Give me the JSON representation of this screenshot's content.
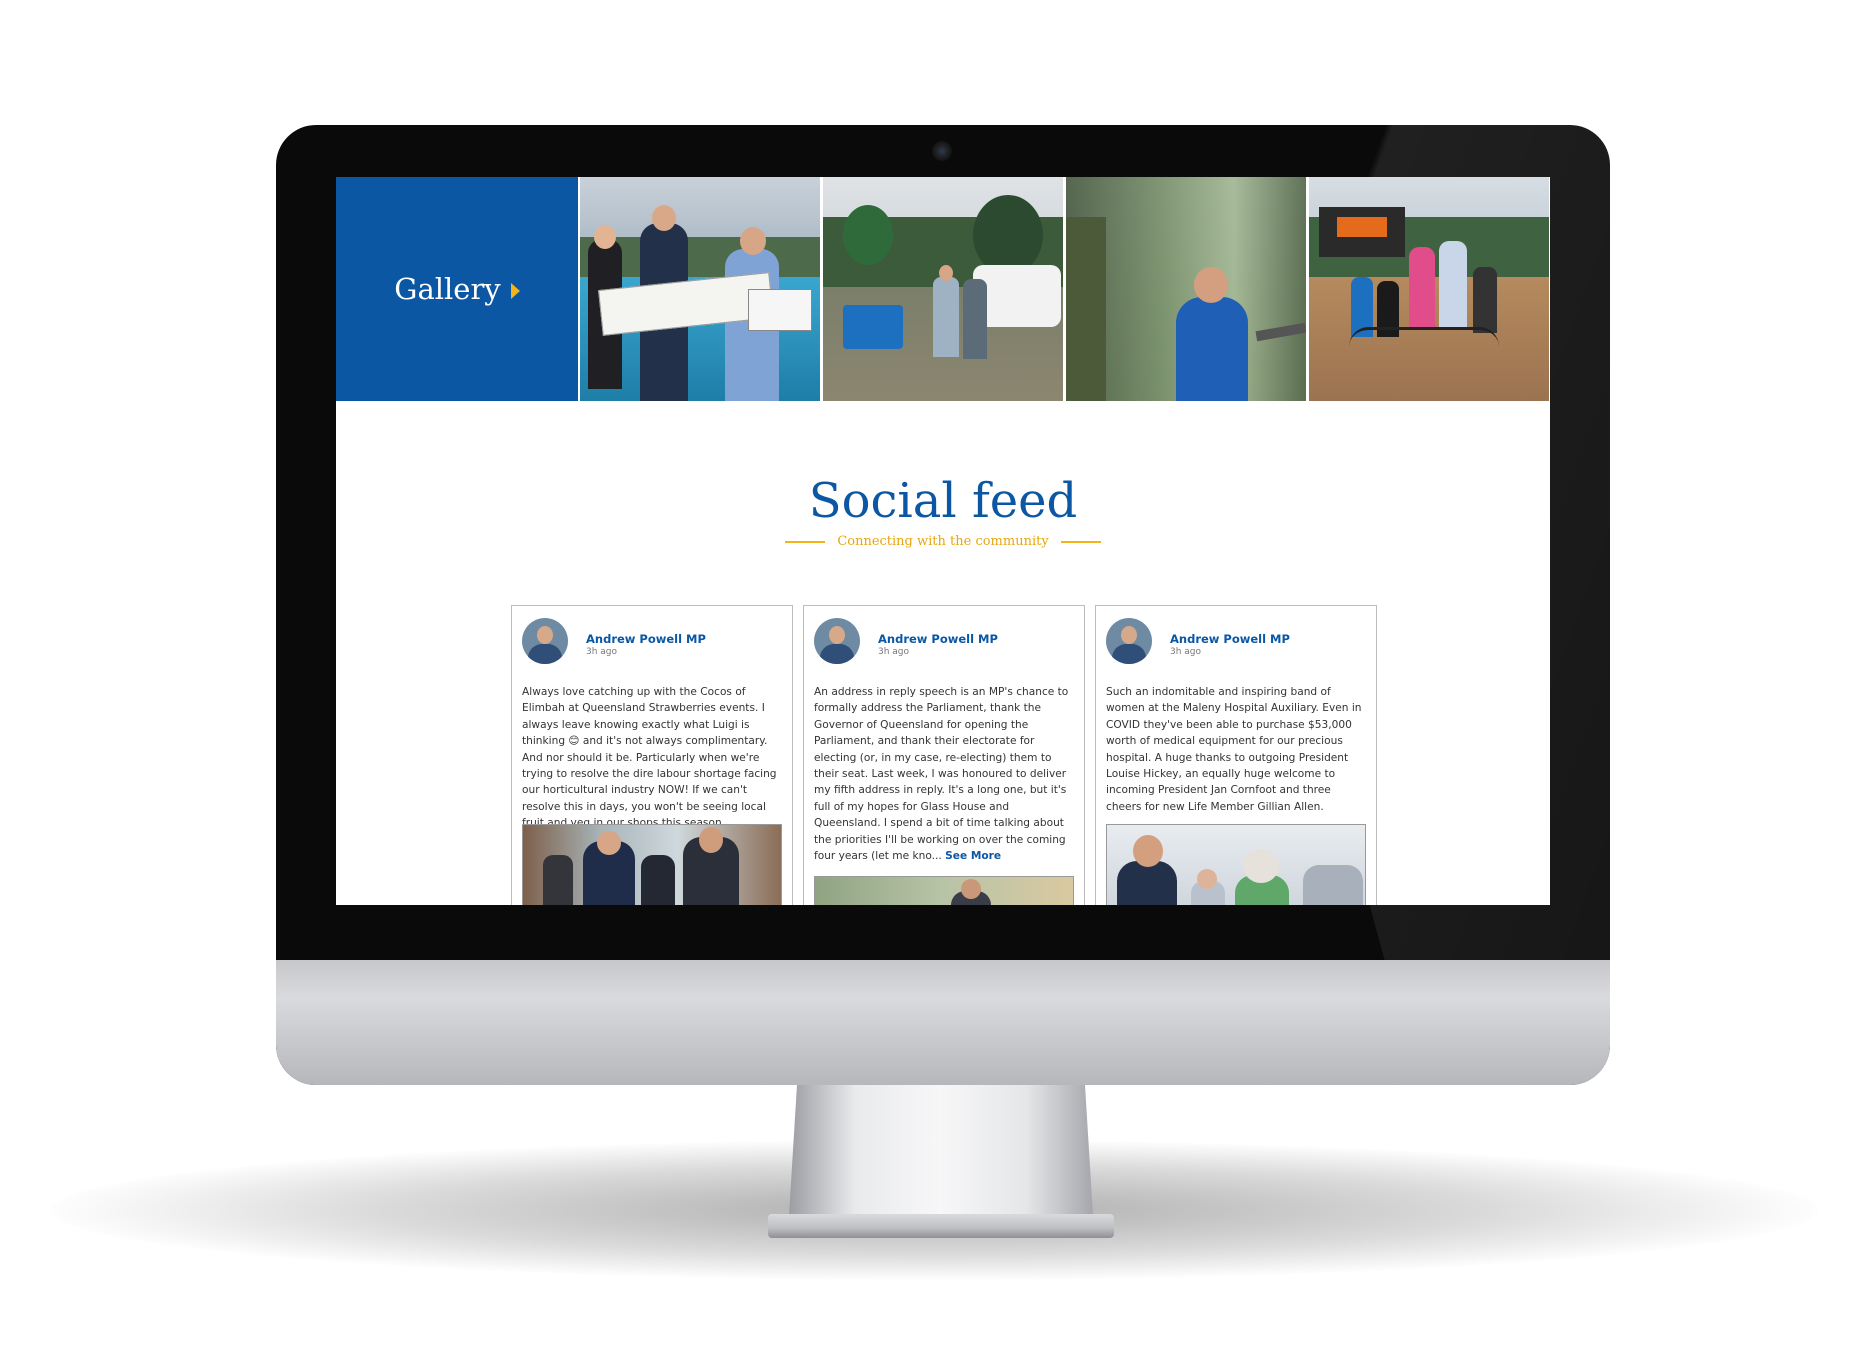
{
  "gallery": {
    "title": "Gallery"
  },
  "feed": {
    "title": "Social feed",
    "subtitle": "Connecting with the community"
  },
  "posts": [
    {
      "author": "Andrew Powell MP",
      "time": "3h ago",
      "text": "Always love catching up with the Cocos of Elimbah at Queensland Strawberries events. I always leave knowing exactly what Luigi is thinking 😊 and it's not always complimentary. And nor should it be. Particularly when we're trying to resolve the dire labour shortage facing our horticultural industry NOW! If we can't resolve this in days, you won't be seeing local fruit and veg in our shops this season.",
      "see_more": ""
    },
    {
      "author": "Andrew Powell MP",
      "time": "3h ago",
      "text": "An address in reply speech is an MP's chance to formally address the Parliament, thank the Governor of Queensland for opening the Parliament, and thank their electorate for electing (or, in my case, re-electing) them to their seat. Last week, I was honoured to deliver my fifth address in reply. It's a long one, but it's full of my hopes for Glass House and Queensland. I spend a bit of time talking about the priorities I'll be working on over the coming four years (let me kno...",
      "see_more": "See More"
    },
    {
      "author": "Andrew Powell MP",
      "time": "3h ago",
      "text": "Such an indomitable and inspiring band of women at the Maleny Hospital Auxiliary. Even in COVID they've been able to purchase $53,000 worth of medical equipment for our precious hospital. A huge thanks to outgoing President Louise Hickey, an equally huge welcome to incoming President Jan Cornfoot and three cheers for new Life Member Gillian Allen.",
      "see_more": ""
    }
  ]
}
